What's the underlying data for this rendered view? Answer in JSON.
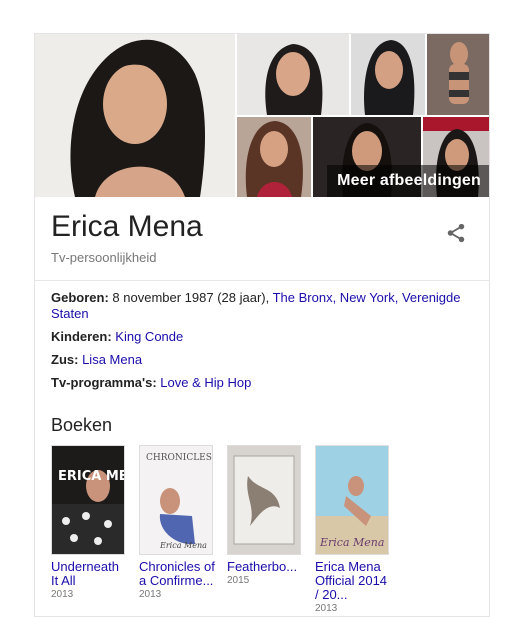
{
  "gallery": {
    "more_label": "Meer afbeeldingen"
  },
  "header": {
    "title": "Erica Mena",
    "subtitle": "Tv-persoonlijkheid"
  },
  "facts": {
    "born_label": "Geboren:",
    "born_text": " 8 november 1987 (28 jaar), ",
    "born_link": "The Bronx, New York, Verenigde Staten",
    "children_label": "Kinderen:",
    "children_link": "King Conde",
    "sister_label": "Zus:",
    "sister_link": "Lisa Mena",
    "tv_label": "Tv-programma's:",
    "tv_link": "Love & Hip Hop"
  },
  "books": {
    "section_title": "Boeken",
    "items": [
      {
        "title": "Underneath It All",
        "year": "2013",
        "cover_text": "ERICA MENA"
      },
      {
        "title": "Chronicles of a Confirme...",
        "year": "2013",
        "cover_text": "CHRONICLES"
      },
      {
        "title": "Featherbo...",
        "year": "2015",
        "cover_text": ""
      },
      {
        "title": "Erica Mena Official 2014 / 20...",
        "year": "2013",
        "cover_text": "Erica Mena"
      }
    ]
  },
  "colors": {
    "link": "#1a0dab",
    "title": "#222222",
    "muted": "#777777"
  }
}
